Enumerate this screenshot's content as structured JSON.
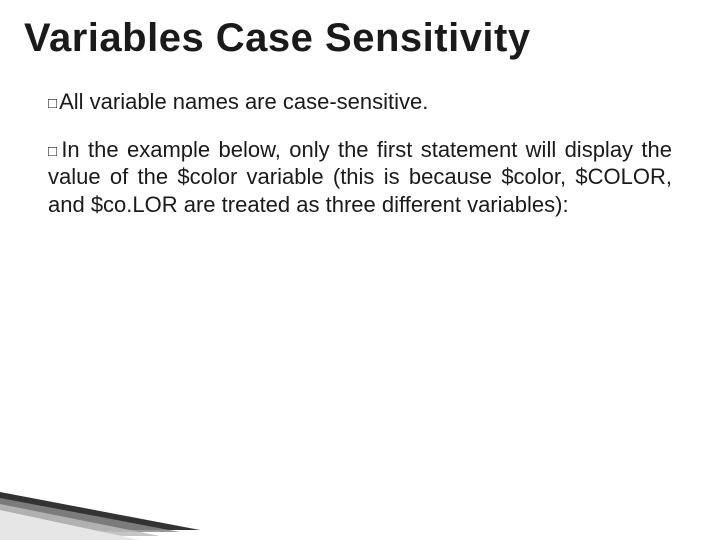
{
  "title": "Variables Case Sensitivity",
  "bullets": [
    {
      "lead": "All",
      "rest": " variable names are case-sensitive."
    },
    {
      "lead": "In",
      "rest": " the example below, only the first statement will display the value of the $color variable (this is because $color, $COLOR, and $co.LOR are treated as three different variables):"
    }
  ]
}
